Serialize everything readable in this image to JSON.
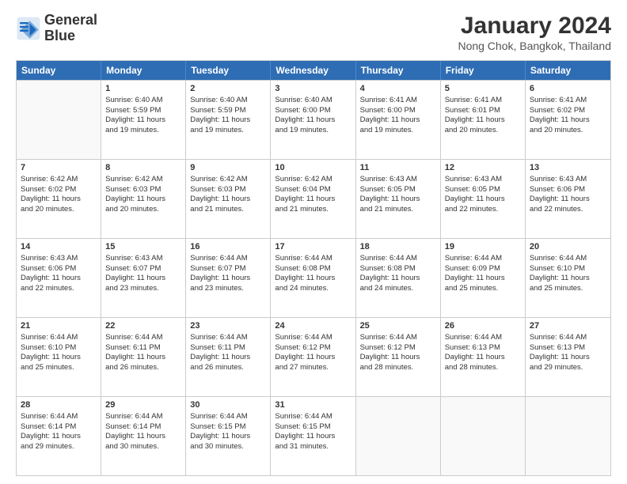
{
  "header": {
    "logo_line1": "General",
    "logo_line2": "Blue",
    "month": "January 2024",
    "location": "Nong Chok, Bangkok, Thailand"
  },
  "weekdays": [
    "Sunday",
    "Monday",
    "Tuesday",
    "Wednesday",
    "Thursday",
    "Friday",
    "Saturday"
  ],
  "weeks": [
    [
      {
        "day": "",
        "info": ""
      },
      {
        "day": "1",
        "info": "Sunrise: 6:40 AM\nSunset: 5:59 PM\nDaylight: 11 hours\nand 19 minutes."
      },
      {
        "day": "2",
        "info": "Sunrise: 6:40 AM\nSunset: 5:59 PM\nDaylight: 11 hours\nand 19 minutes."
      },
      {
        "day": "3",
        "info": "Sunrise: 6:40 AM\nSunset: 6:00 PM\nDaylight: 11 hours\nand 19 minutes."
      },
      {
        "day": "4",
        "info": "Sunrise: 6:41 AM\nSunset: 6:00 PM\nDaylight: 11 hours\nand 19 minutes."
      },
      {
        "day": "5",
        "info": "Sunrise: 6:41 AM\nSunset: 6:01 PM\nDaylight: 11 hours\nand 20 minutes."
      },
      {
        "day": "6",
        "info": "Sunrise: 6:41 AM\nSunset: 6:02 PM\nDaylight: 11 hours\nand 20 minutes."
      }
    ],
    [
      {
        "day": "7",
        "info": "Sunrise: 6:42 AM\nSunset: 6:02 PM\nDaylight: 11 hours\nand 20 minutes."
      },
      {
        "day": "8",
        "info": "Sunrise: 6:42 AM\nSunset: 6:03 PM\nDaylight: 11 hours\nand 20 minutes."
      },
      {
        "day": "9",
        "info": "Sunrise: 6:42 AM\nSunset: 6:03 PM\nDaylight: 11 hours\nand 21 minutes."
      },
      {
        "day": "10",
        "info": "Sunrise: 6:42 AM\nSunset: 6:04 PM\nDaylight: 11 hours\nand 21 minutes."
      },
      {
        "day": "11",
        "info": "Sunrise: 6:43 AM\nSunset: 6:05 PM\nDaylight: 11 hours\nand 21 minutes."
      },
      {
        "day": "12",
        "info": "Sunrise: 6:43 AM\nSunset: 6:05 PM\nDaylight: 11 hours\nand 22 minutes."
      },
      {
        "day": "13",
        "info": "Sunrise: 6:43 AM\nSunset: 6:06 PM\nDaylight: 11 hours\nand 22 minutes."
      }
    ],
    [
      {
        "day": "14",
        "info": "Sunrise: 6:43 AM\nSunset: 6:06 PM\nDaylight: 11 hours\nand 22 minutes."
      },
      {
        "day": "15",
        "info": "Sunrise: 6:43 AM\nSunset: 6:07 PM\nDaylight: 11 hours\nand 23 minutes."
      },
      {
        "day": "16",
        "info": "Sunrise: 6:44 AM\nSunset: 6:07 PM\nDaylight: 11 hours\nand 23 minutes."
      },
      {
        "day": "17",
        "info": "Sunrise: 6:44 AM\nSunset: 6:08 PM\nDaylight: 11 hours\nand 24 minutes."
      },
      {
        "day": "18",
        "info": "Sunrise: 6:44 AM\nSunset: 6:08 PM\nDaylight: 11 hours\nand 24 minutes."
      },
      {
        "day": "19",
        "info": "Sunrise: 6:44 AM\nSunset: 6:09 PM\nDaylight: 11 hours\nand 25 minutes."
      },
      {
        "day": "20",
        "info": "Sunrise: 6:44 AM\nSunset: 6:10 PM\nDaylight: 11 hours\nand 25 minutes."
      }
    ],
    [
      {
        "day": "21",
        "info": "Sunrise: 6:44 AM\nSunset: 6:10 PM\nDaylight: 11 hours\nand 25 minutes."
      },
      {
        "day": "22",
        "info": "Sunrise: 6:44 AM\nSunset: 6:11 PM\nDaylight: 11 hours\nand 26 minutes."
      },
      {
        "day": "23",
        "info": "Sunrise: 6:44 AM\nSunset: 6:11 PM\nDaylight: 11 hours\nand 26 minutes."
      },
      {
        "day": "24",
        "info": "Sunrise: 6:44 AM\nSunset: 6:12 PM\nDaylight: 11 hours\nand 27 minutes."
      },
      {
        "day": "25",
        "info": "Sunrise: 6:44 AM\nSunset: 6:12 PM\nDaylight: 11 hours\nand 28 minutes."
      },
      {
        "day": "26",
        "info": "Sunrise: 6:44 AM\nSunset: 6:13 PM\nDaylight: 11 hours\nand 28 minutes."
      },
      {
        "day": "27",
        "info": "Sunrise: 6:44 AM\nSunset: 6:13 PM\nDaylight: 11 hours\nand 29 minutes."
      }
    ],
    [
      {
        "day": "28",
        "info": "Sunrise: 6:44 AM\nSunset: 6:14 PM\nDaylight: 11 hours\nand 29 minutes."
      },
      {
        "day": "29",
        "info": "Sunrise: 6:44 AM\nSunset: 6:14 PM\nDaylight: 11 hours\nand 30 minutes."
      },
      {
        "day": "30",
        "info": "Sunrise: 6:44 AM\nSunset: 6:15 PM\nDaylight: 11 hours\nand 30 minutes."
      },
      {
        "day": "31",
        "info": "Sunrise: 6:44 AM\nSunset: 6:15 PM\nDaylight: 11 hours\nand 31 minutes."
      },
      {
        "day": "",
        "info": ""
      },
      {
        "day": "",
        "info": ""
      },
      {
        "day": "",
        "info": ""
      }
    ]
  ]
}
